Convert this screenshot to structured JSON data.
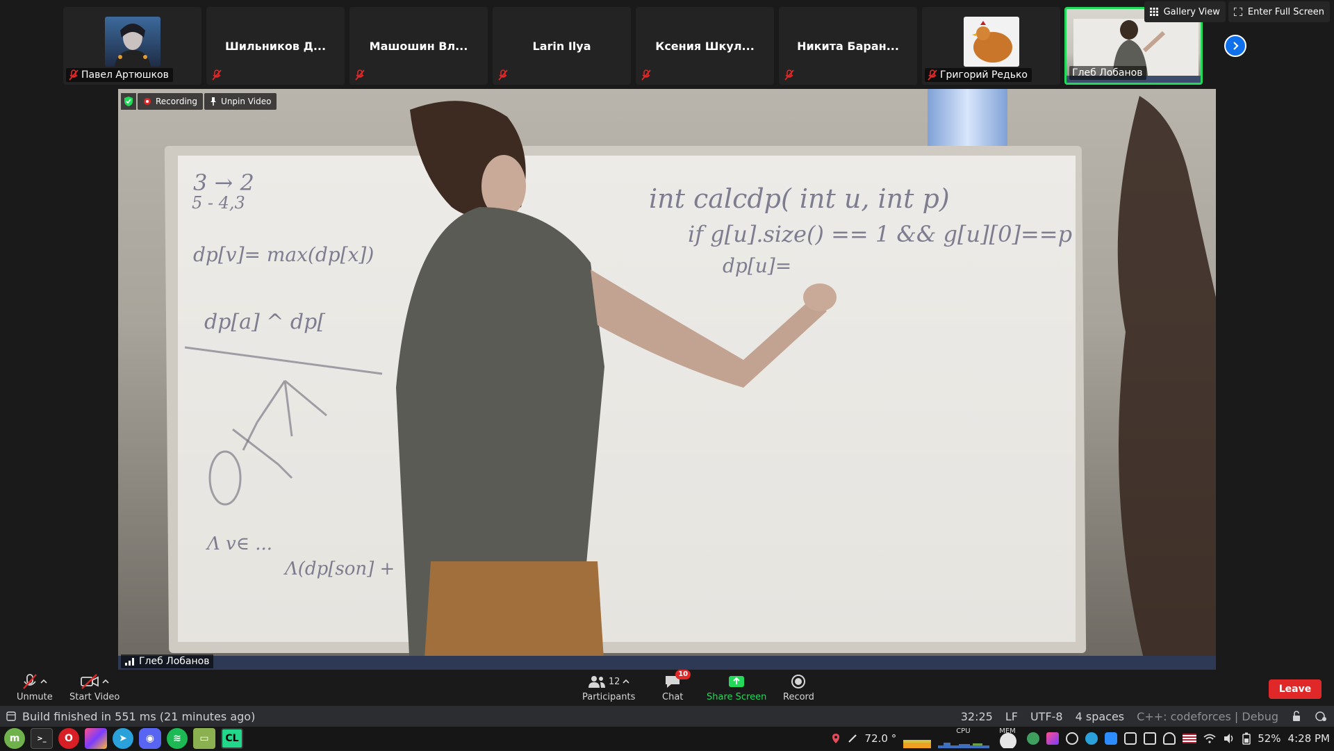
{
  "participants": [
    {
      "name": "Павел Артюшков",
      "avatar": "photo",
      "muted": true
    },
    {
      "name": "Шильников Д...",
      "muted": true
    },
    {
      "name": "Машошин Вл...",
      "muted": true
    },
    {
      "name": "Larin Ilya",
      "muted": true
    },
    {
      "name": "Ксения Шкул...",
      "muted": true
    },
    {
      "name": "Никита Баран...",
      "muted": true
    },
    {
      "name": "Григорий Редько",
      "avatar": "hen-photo",
      "muted": true
    },
    {
      "name": "Глеб Лобанов",
      "avatar": "video",
      "active": true
    }
  ],
  "view": {
    "gallery": "Gallery View",
    "fullscreen": "Enter Full Screen"
  },
  "video": {
    "recording": "Recording",
    "unpin": "Unpin Video",
    "speaker": "Глеб Лобанов",
    "board_text": {
      "line1": "int calcdp( int u, int p)",
      "line2": "if g[u].size() == 1 && g[u][0]==p",
      "line3": "dp[u]=",
      "left1": "3 → 2",
      "left2": "5 - 4,3",
      "left3": "dp[v]= max(dp[x])",
      "left4": "dp[a] ^ dp[",
      "left5": "Λ v∈ ...",
      "left6": "Λ(dp[son] +"
    }
  },
  "controls": {
    "unmute": "Unmute",
    "start_video": "Start Video",
    "participants": "Participants",
    "participants_count": "12",
    "chat": "Chat",
    "chat_badge": "10",
    "share": "Share Screen",
    "record": "Record",
    "leave": "Leave"
  },
  "statusbar": {
    "build": "Build finished in 551 ms (21 minutes ago)",
    "position": "32:25",
    "line_ending": "LF",
    "encoding": "UTF-8",
    "indent": "4 spaces",
    "context": "C++: codeforces | Debug"
  },
  "taskbar": {
    "temp": "72.0 °",
    "cpu": "CPU",
    "mem": "MEM",
    "battery": "52%",
    "time": "4:28 PM"
  },
  "colors": {
    "accent_green": "#23d959",
    "zoom_blue": "#0e71eb",
    "leave_red": "#e02828"
  }
}
